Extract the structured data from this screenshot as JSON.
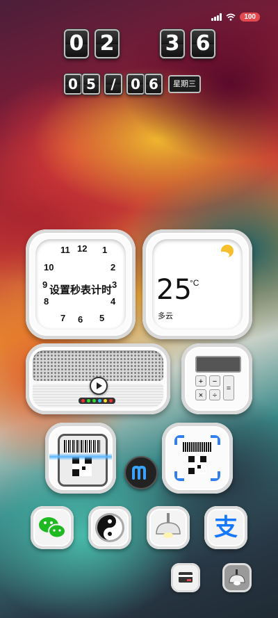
{
  "status_bar": {
    "battery": "100"
  },
  "clock": {
    "h1": "0",
    "h2": "2",
    "m1": "3",
    "m2": "6"
  },
  "date": {
    "d1": "0",
    "d2": "5",
    "sep": "/",
    "d3": "0",
    "d4": "6",
    "weekday": "星期三"
  },
  "clock_widget": {
    "label": "设置秒表计时",
    "numbers": [
      "11",
      "12",
      "1",
      "10",
      "2",
      "9",
      "3",
      "4",
      "8",
      "7",
      "6",
      "5"
    ]
  },
  "weather_widget": {
    "temp": "25",
    "unit": "°C",
    "condition": "多云"
  },
  "calculator_widget": {
    "keys": [
      "+",
      "−",
      "×",
      "÷",
      "="
    ]
  },
  "apps": [
    {
      "name": "wechat"
    },
    {
      "name": "taiji"
    },
    {
      "name": "lamp"
    },
    {
      "name": "alipay",
      "glyph": "支"
    }
  ],
  "colors": {
    "wechat": "#1fb922",
    "alipay": "#1677ff",
    "battery": "#e24a4f"
  }
}
